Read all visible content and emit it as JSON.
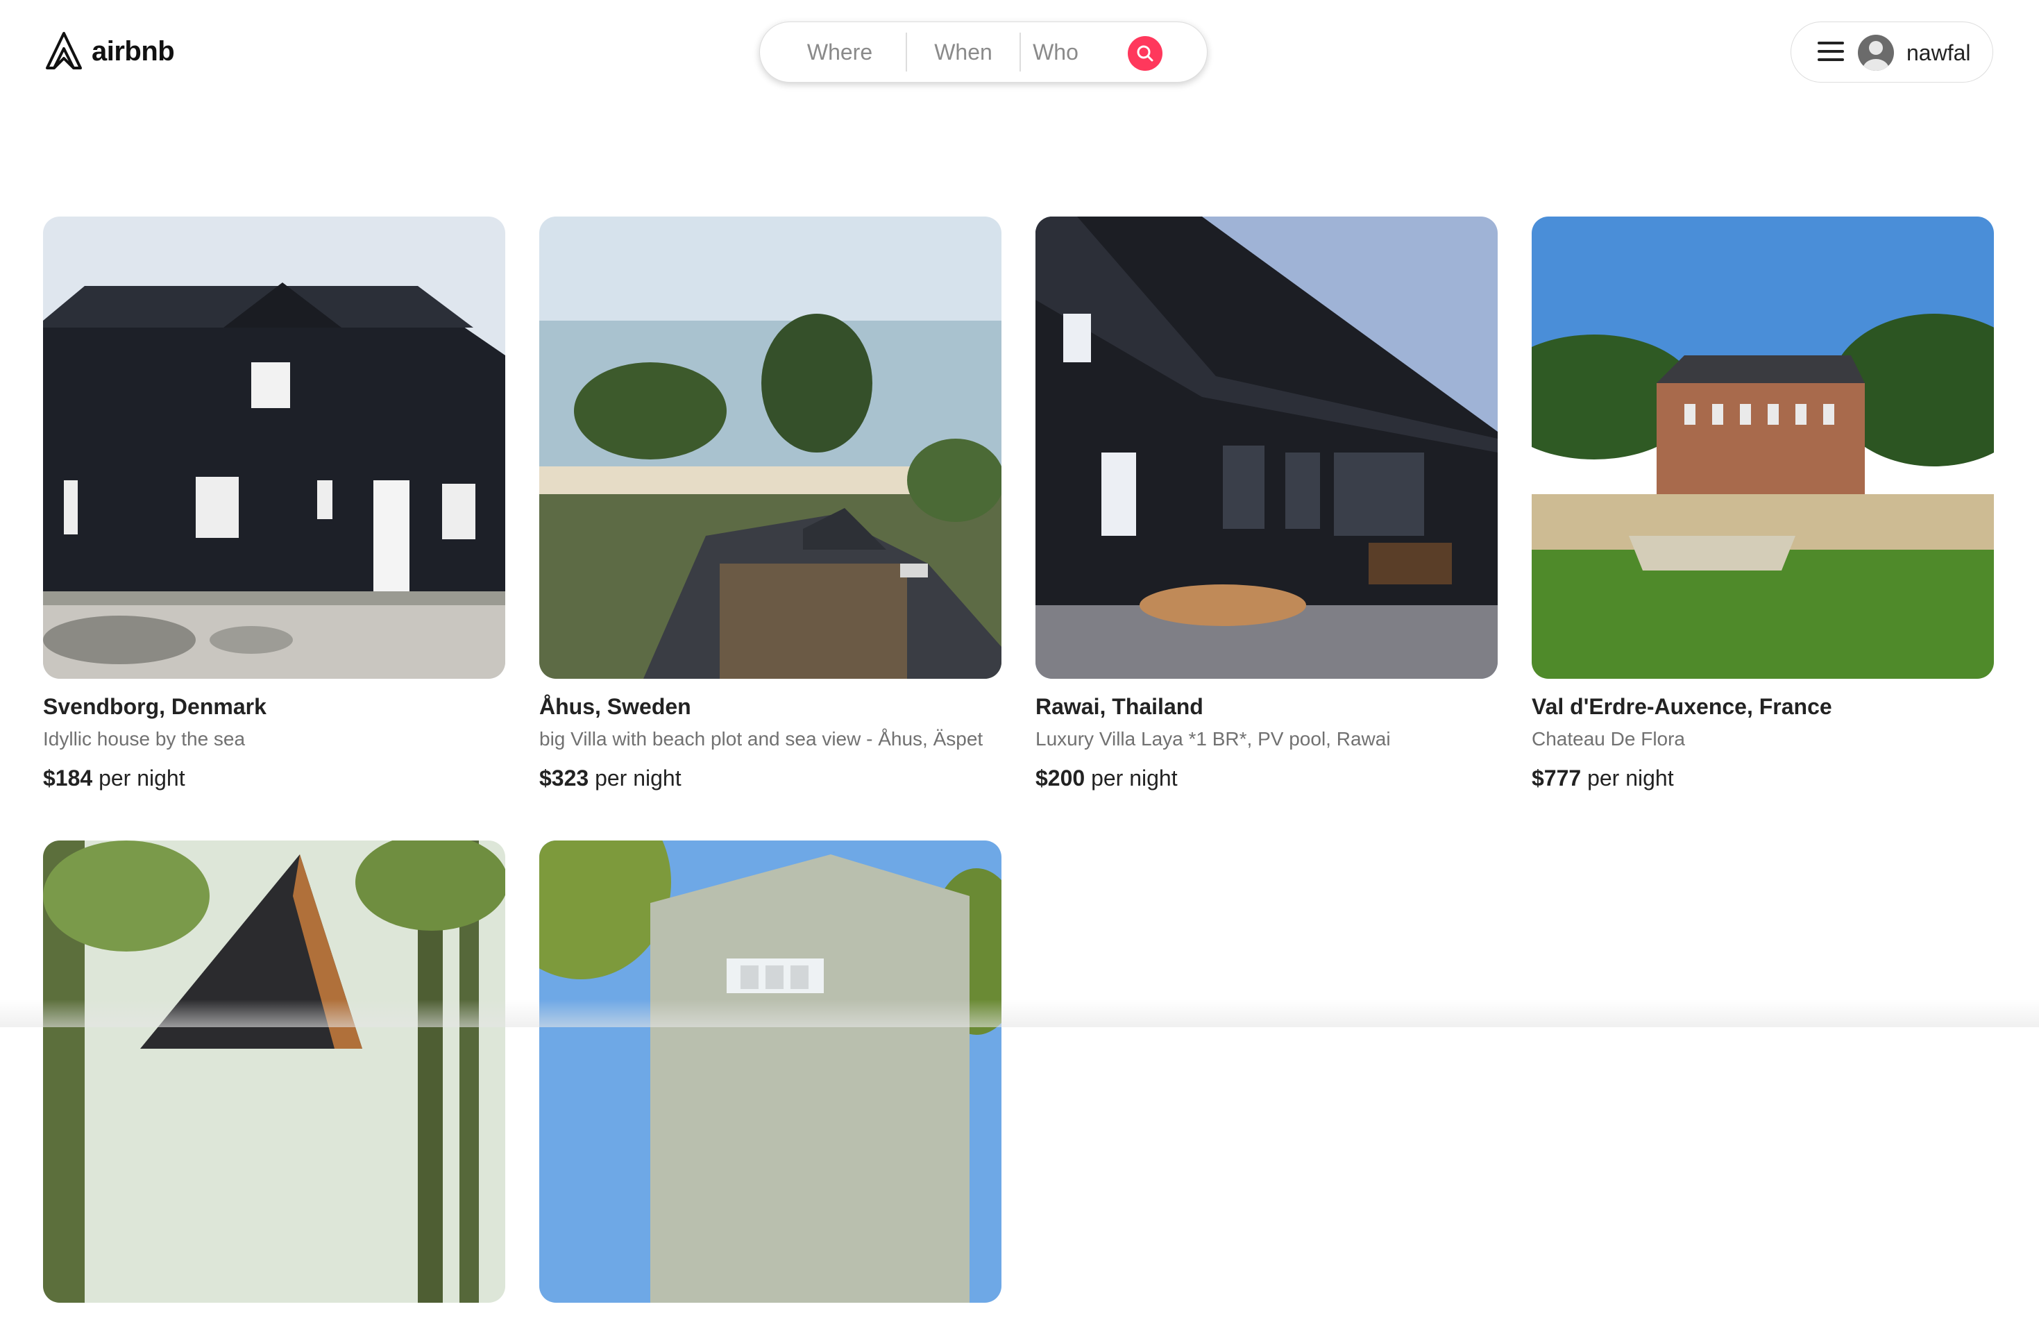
{
  "header": {
    "logo_text": "airbnb",
    "search": {
      "where": "Where",
      "when": "When",
      "who": "Who",
      "accent_color": "#ff385c"
    },
    "user": {
      "name": "nawfal"
    }
  },
  "listings": [
    {
      "location": "Svendborg, Denmark",
      "title": "Idyllic house by the sea",
      "price": "$184",
      "price_unit": "per night"
    },
    {
      "location": "Åhus, Sweden",
      "title": "big Villa with beach plot and sea view - Åhus, Äspet",
      "price": "$323",
      "price_unit": "per night"
    },
    {
      "location": "Rawai, Thailand",
      "title": "Luxury Villa Laya *1 BR*, PV pool, Rawai",
      "price": "$200",
      "price_unit": "per night"
    },
    {
      "location": "Val d'Erdre-Auxence, France",
      "title": "Chateau De Flora",
      "price": "$777",
      "price_unit": "per night"
    },
    {
      "location": "",
      "title": "",
      "price": "",
      "price_unit": ""
    },
    {
      "location": "",
      "title": "",
      "price": "",
      "price_unit": ""
    }
  ]
}
